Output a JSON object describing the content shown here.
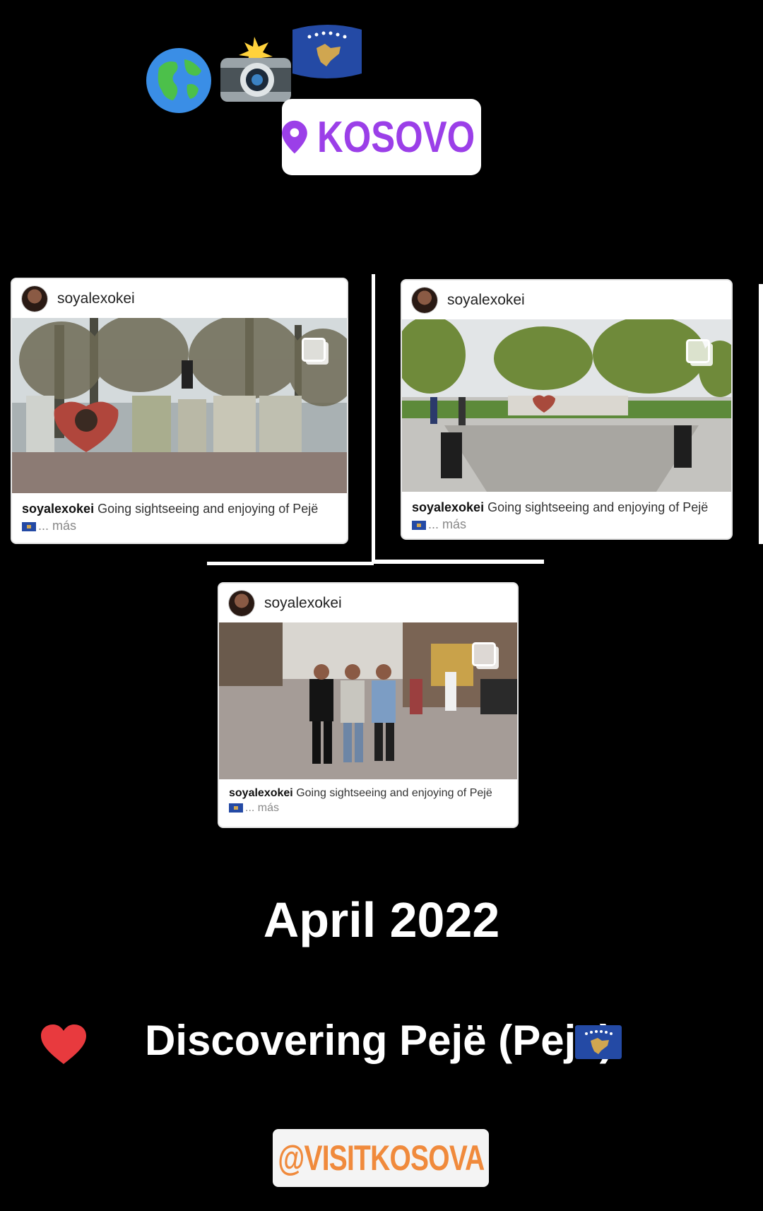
{
  "stickers": {
    "globe_icon": "globe-emoji",
    "camera_icon": "camera-flash-emoji",
    "flag_icon": "kosovo-flag-emoji",
    "location": "KOSOVO",
    "location_color": "#9b3fe8",
    "mention": "@VISITKOSOVA",
    "mention_color": "#f08a3c"
  },
  "posts": [
    {
      "username": "soyalexokei",
      "caption_user": "soyalexokei",
      "caption_text": "Going sightseeing and enjoying of Pejë",
      "more": "... más",
      "photo_subject": "I love PEJA letters sign in park"
    },
    {
      "username": "soyalexokei",
      "caption_user": "soyalexokei",
      "caption_text": "Going sightseeing and enjoying of Pejë",
      "more": "... más",
      "photo_subject": "park square with PEJA sign"
    },
    {
      "username": "soyalexokei",
      "caption_user": "soyalexokei",
      "caption_text": "Going sightseeing and enjoying of Pejë",
      "more": "... más",
      "photo_subject": "three friends on pedestrian street"
    }
  ],
  "date": "April 2022",
  "headline": "Discovering Pejë (Peja)",
  "heart_icon": "red-heart-emoji",
  "headline_flag_icon": "kosovo-flag-emoji"
}
